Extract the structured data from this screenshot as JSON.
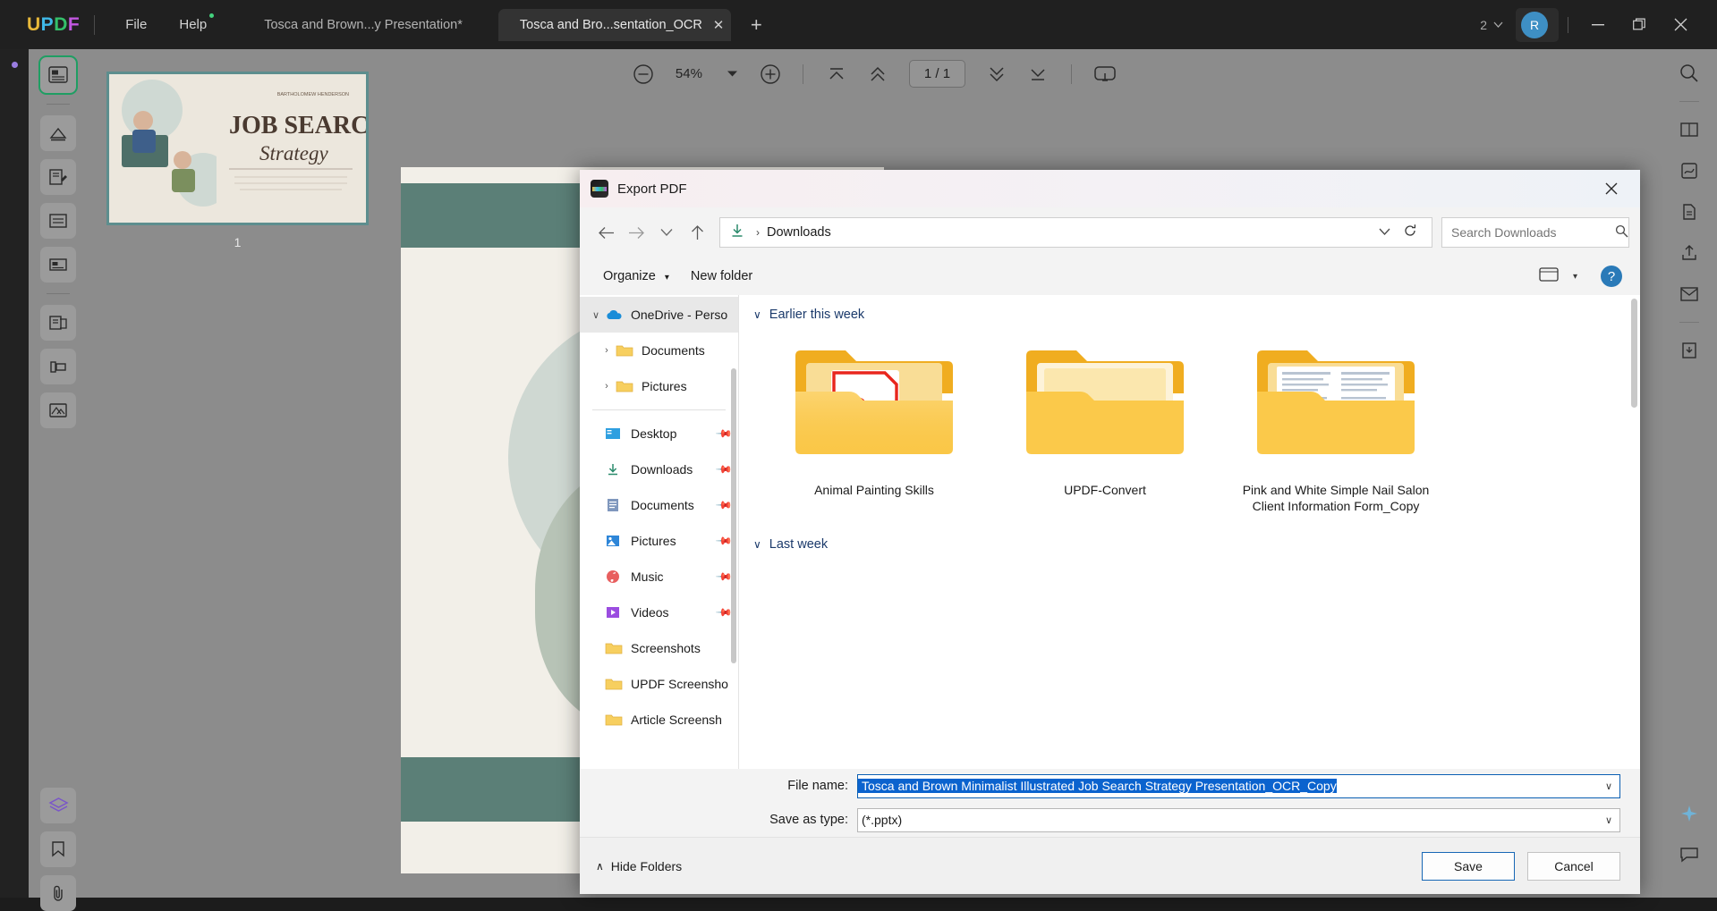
{
  "app": {
    "logo": [
      "U",
      "P",
      "D",
      "F"
    ],
    "menus": [
      {
        "label": "File",
        "has_dot": false
      },
      {
        "label": "Help",
        "has_dot": true
      }
    ],
    "tabs": [
      {
        "label": "Tosca and Brown...y Presentation*",
        "active": false
      },
      {
        "label": "Tosca and Bro...sentation_OCR",
        "active": true
      }
    ],
    "new_tab_label": "+",
    "window": {
      "page_count": "2",
      "avatar_initial": "R",
      "minimize": "—",
      "maximize": "❐",
      "close": "✕"
    }
  },
  "toolbar": {
    "zoom_out": "zoom-out-icon",
    "zoom_value": "54%",
    "zoom_dropdown": "▾",
    "zoom_in": "zoom-in-icon",
    "first_page": "first-page-icon",
    "prev_page": "previous-page-icon",
    "page_indicator": "1 / 1",
    "next_page": "next-page-icon",
    "last_page": "last-page-icon",
    "presentation": "presentation-mode-icon"
  },
  "thumbnail_panel": {
    "page_number": "1",
    "slide_title_line1": "JOB SEARCH",
    "slide_title_line2": "Strategy",
    "slide_author": "BARTHOLOMEW HENDERSON"
  },
  "dialog": {
    "title": "Export PDF",
    "close_label": "✕",
    "nav": {
      "back": "←",
      "forward": "→",
      "recent": "∨",
      "up": "↑",
      "breadcrumb_icon": "downloads-icon",
      "breadcrumb_sep": "›",
      "breadcrumb": "Downloads",
      "breadcrumb_chevron": "∨",
      "refresh": "↻",
      "search_placeholder": "Search Downloads",
      "search_value": ""
    },
    "commandbar": {
      "organize": "Organize",
      "organize_caret": "▾",
      "new_folder": "New folder",
      "view_label": "view-options-icon",
      "view_caret": "▾",
      "help": "?"
    },
    "sidebar": [
      {
        "label": "OneDrive - Perso",
        "icon": "onedrive-cloud-icon",
        "chevron": "∨",
        "selected": true,
        "indent": 0,
        "pinned": false
      },
      {
        "label": "Documents",
        "icon": "folder-icon",
        "chevron": "›",
        "selected": false,
        "indent": 1,
        "pinned": false
      },
      {
        "label": "Pictures",
        "icon": "folder-icon",
        "chevron": "›",
        "selected": false,
        "indent": 1,
        "pinned": false
      },
      {
        "label": "Desktop",
        "icon": "desktop-icon",
        "chevron": "",
        "selected": false,
        "indent": 1,
        "pinned": true
      },
      {
        "label": "Downloads",
        "icon": "downloads-icon",
        "chevron": "",
        "selected": false,
        "indent": 1,
        "pinned": true
      },
      {
        "label": "Documents",
        "icon": "documents-icon",
        "chevron": "",
        "selected": false,
        "indent": 1,
        "pinned": true
      },
      {
        "label": "Pictures",
        "icon": "pictures-icon",
        "chevron": "",
        "selected": false,
        "indent": 1,
        "pinned": true
      },
      {
        "label": "Music",
        "icon": "music-icon",
        "chevron": "",
        "selected": false,
        "indent": 1,
        "pinned": true
      },
      {
        "label": "Videos",
        "icon": "videos-icon",
        "chevron": "",
        "selected": false,
        "indent": 1,
        "pinned": true
      },
      {
        "label": "Screenshots",
        "icon": "folder-icon",
        "chevron": "",
        "selected": false,
        "indent": 1,
        "pinned": false
      },
      {
        "label": "UPDF Screensho",
        "icon": "folder-icon",
        "chevron": "",
        "selected": false,
        "indent": 1,
        "pinned": false
      },
      {
        "label": "Article Screensh",
        "icon": "folder-icon",
        "chevron": "",
        "selected": false,
        "indent": 1,
        "pinned": false
      }
    ],
    "groups": [
      {
        "header": "Earlier this week",
        "chevron": "∨",
        "items": [
          {
            "name": "Animal Painting Skills",
            "thumb": "folder-with-pdf"
          },
          {
            "name": "UPDF-Convert",
            "thumb": "folder-with-doc"
          },
          {
            "name": "Pink and White Simple Nail Salon Client Information Form_Copy",
            "thumb": "folder-with-form"
          }
        ]
      },
      {
        "header": "Last week",
        "chevron": "∨",
        "items": []
      }
    ],
    "fields": {
      "filename_label": "File name:",
      "filename_value": "Tosca and Brown Minimalist Illustrated Job Search Strategy Presentation_OCR_Copy",
      "filetype_label": "Save as type:",
      "filetype_value": "(*.pptx)",
      "caret": "∨"
    },
    "footer": {
      "hide_folders": "Hide Folders",
      "hide_folders_chevron": "∧",
      "save": "Save",
      "cancel": "Cancel"
    }
  },
  "colors": {
    "accent_blue": "#0b63ce",
    "folder_yellow": "#f5b723",
    "titlebar_bg": "#202020",
    "workspace_bg": "#8c8c8c",
    "dialog_bg": "#f3f3f3",
    "selection_blue": "#1767b5",
    "group_header": "#1b3a6b"
  }
}
